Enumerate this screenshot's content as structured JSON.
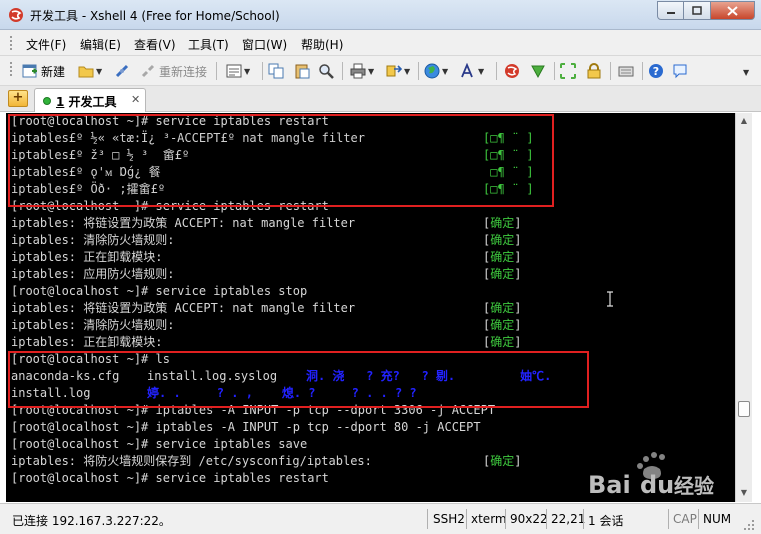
{
  "window": {
    "title": "开发工具 - Xshell 4 (Free for Home/School)",
    "accent_color": "#d8e4f2"
  },
  "menu": [
    "文件(F)",
    "编辑(E)",
    "查看(V)",
    "工具(T)",
    "窗口(W)",
    "帮助(H)"
  ],
  "toolbar": {
    "new_label": "新建",
    "reconnect_label": "重新连接"
  },
  "tab": {
    "number": "1",
    "label": "开发工具"
  },
  "terminal": {
    "lines": [
      "[root@localhost ~]# service iptables restart",
      "iptables£º ½« «tæ:Ï¿ ³-ACCEPT£º nat mangle filter",
      "iptables£º ž³ □ ½ ³  畲£º",
      "iptables£º ǫ'ᴍ Ɒǵ¿ 餐",
      "iptables£º Öð· ;攉畲£º",
      "[root@localhost ~]# service iptables restart",
      "iptables: 将链设置为政策 ACCEPT: nat mangle filter",
      "iptables: 清除防火墙规则:",
      "iptables: 正在卸载模块:",
      "iptables: 应用防火墙规则:",
      "[root@localhost ~]# service iptables stop",
      "iptables: 将链设置为政策 ACCEPT: nat mangle filter",
      "iptables: 清除防火墙规则:",
      "iptables: 正在卸载模块:",
      "[root@localhost ~]# ls",
      "anaconda-ks.cfg",
      "install.log",
      "[root@localhost ~]# iptables -A INPUT -p tcp --dport 3306 -j ACCEPT",
      "[root@localhost ~]# iptables -A INPUT -p tcp --dport 80 -j ACCEPT",
      "[root@localhost ~]# service iptables save",
      "iptables: 将防火墙规则保存到 /etc/sysconfig/iptables:",
      "[root@localhost ~]# service iptables restart"
    ],
    "status_garbled": [
      "[□¶ ¨ ]",
      "[□¶ ¨ ]",
      " □¶ ¨ ]",
      "[□¶ ¨ ]"
    ],
    "ok_word": "确定",
    "ls_col2": [
      "install.log.syslog",
      ""
    ],
    "ls_blue_row1": "洞. 浇   ? 充?   ? 剔.         妯℃.",
    "ls_blue_row2": "婷. .     ? . ,    熄. ?     ? . . ? ?"
  },
  "status": {
    "connection": "已连接 192.167.3.227:22。",
    "protocol": "SSH2",
    "terminal_type": "xterm",
    "size": "90x22",
    "cursor_pos": "22,21",
    "sessions": "1 会话",
    "caps": "CAP",
    "num": "NUM"
  },
  "watermark": {
    "brand": "Bai",
    "brand2": "du",
    "suffix": "经验"
  }
}
